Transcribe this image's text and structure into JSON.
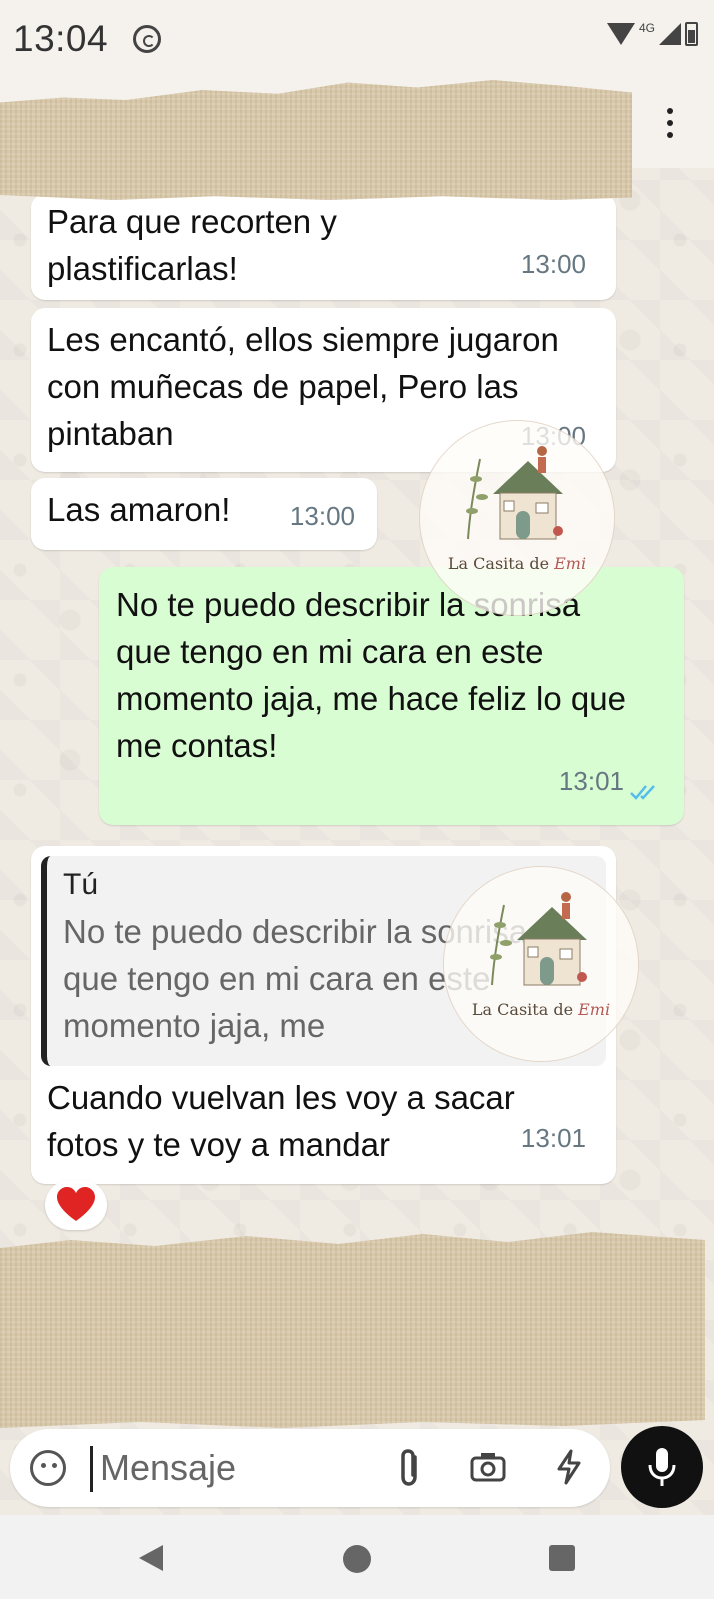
{
  "status_bar": {
    "time": "13:04",
    "network": "4G"
  },
  "messages": [
    {
      "direction": "in",
      "text": "Para que recorten y plastificarlas!",
      "time": "13:00"
    },
    {
      "direction": "in",
      "text": "Les encantó, ellos siempre jugaron con muñecas de papel, Pero las pintaban",
      "time": "13:00"
    },
    {
      "direction": "in",
      "text": "Las amaron!",
      "time": "13:00"
    },
    {
      "direction": "out",
      "text": "No te puedo describir la sonrisa que tengo en mi cara en este momento jaja, me hace feliz lo que me contas!",
      "time": "13:01",
      "status": "read"
    },
    {
      "direction": "in",
      "quote": {
        "author": "Tú",
        "text": "No te puedo describir la sonrisa que tengo en mi cara en este momento jaja, me"
      },
      "text": "Cuando vuelvan les voy a sacar fotos y te voy a mandar",
      "time": "13:01",
      "reaction": "❤️"
    }
  ],
  "watermark": {
    "label": "La Casita de",
    "script": "Emi"
  },
  "composer": {
    "placeholder": "Mensaje"
  },
  "colors": {
    "outgoing_bubble": "#d9fdd3",
    "incoming_bubble": "#ffffff",
    "chat_background": "#efeae2",
    "read_ticks": "#53bdeb",
    "tape": "#d8c8aa"
  }
}
